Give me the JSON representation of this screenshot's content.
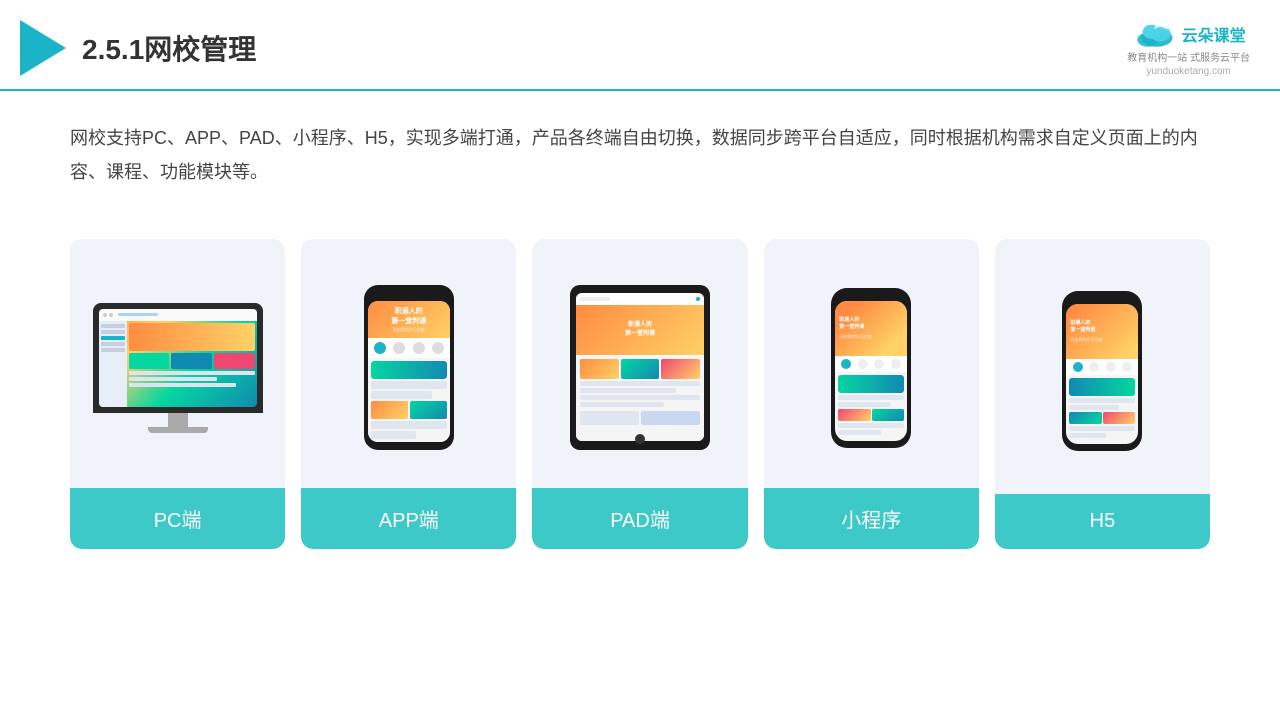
{
  "header": {
    "title": "2.5.1网校管理",
    "brand": {
      "name": "云朵课堂",
      "url": "yunduoketang.com",
      "tagline1": "教育机构一站",
      "tagline2": "式服务云平台"
    }
  },
  "description": "网校支持PC、APP、PAD、小程序、H5，实现多端打通，产品各终端自由切换，数据同步跨平台自适应，同时根据机构需求自定义页面上的内容、课程、功能模块等。",
  "cards": [
    {
      "id": "pc",
      "label": "PC端"
    },
    {
      "id": "app",
      "label": "APP端"
    },
    {
      "id": "pad",
      "label": "PAD端"
    },
    {
      "id": "miniapp",
      "label": "小程序"
    },
    {
      "id": "h5",
      "label": "H5"
    }
  ]
}
